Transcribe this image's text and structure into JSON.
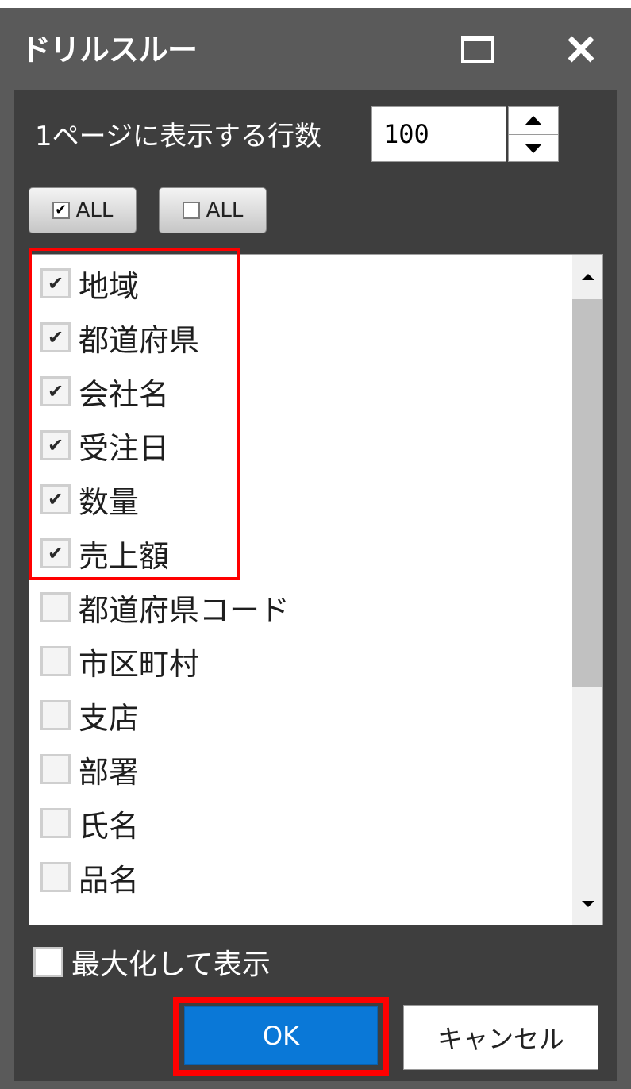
{
  "window": {
    "title": "ドリルスルー"
  },
  "rows_per_page": {
    "label": "1ページに表示する行数",
    "value": "100"
  },
  "toolbar": {
    "check_all_label": "ALL",
    "uncheck_all_label": "ALL"
  },
  "fields": [
    {
      "label": "地域",
      "checked": true
    },
    {
      "label": "都道府県",
      "checked": true
    },
    {
      "label": "会社名",
      "checked": true
    },
    {
      "label": "受注日",
      "checked": true
    },
    {
      "label": "数量",
      "checked": true
    },
    {
      "label": "売上額",
      "checked": true
    },
    {
      "label": "都道府県コード",
      "checked": false
    },
    {
      "label": "市区町村",
      "checked": false
    },
    {
      "label": "支店",
      "checked": false
    },
    {
      "label": "部署",
      "checked": false
    },
    {
      "label": "氏名",
      "checked": false
    },
    {
      "label": "品名",
      "checked": false
    }
  ],
  "maximize_option": {
    "label": "最大化して表示",
    "checked": false
  },
  "footer": {
    "ok_label": "OK",
    "cancel_label": "キャンセル"
  },
  "colors": {
    "title_bar": "#5a5a5a",
    "panel": "#3e3e3e",
    "ok_button": "#0a78d7",
    "highlight": "#ff0000"
  }
}
